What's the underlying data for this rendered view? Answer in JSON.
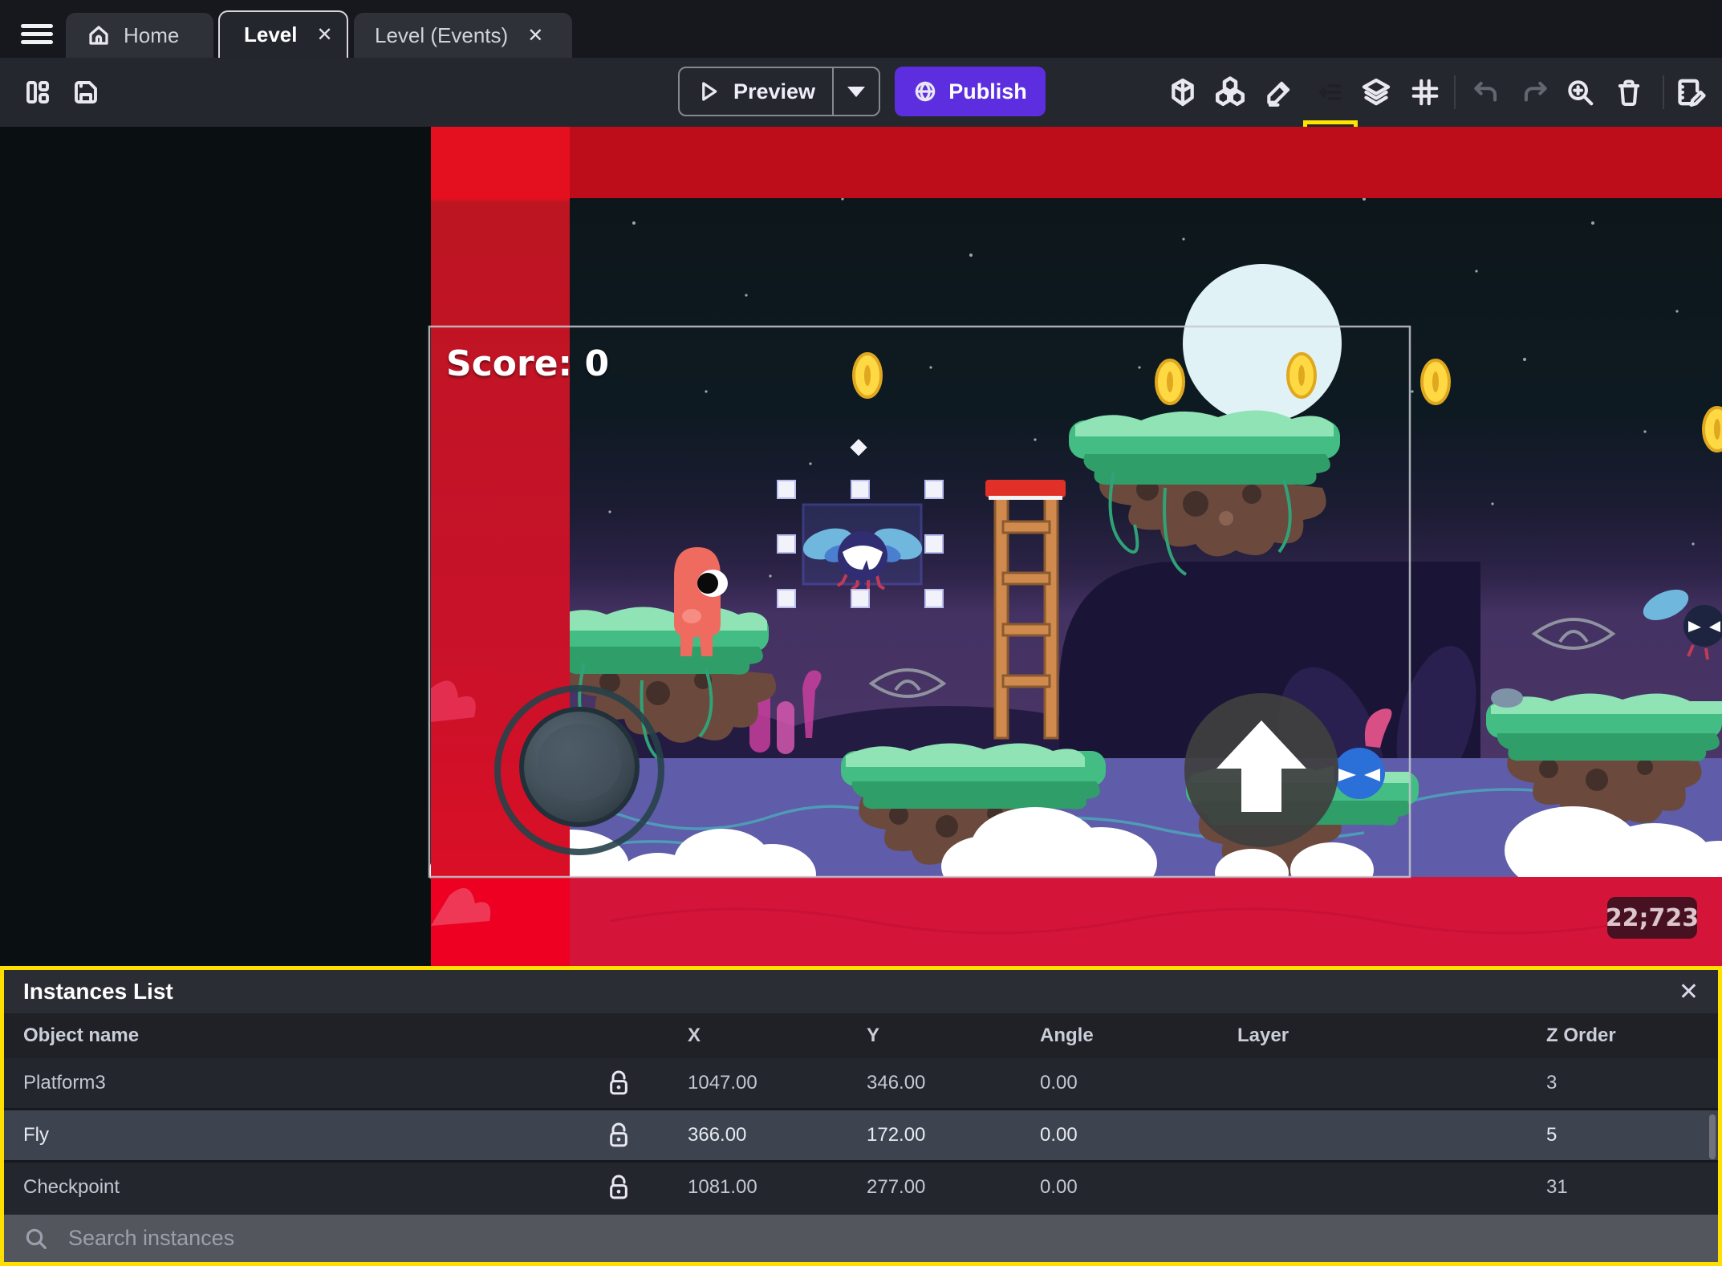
{
  "tab_bar": {
    "home": {
      "label": "Home"
    },
    "level": {
      "label": "Level",
      "close": "✕"
    },
    "level_events": {
      "label": "Level (Events)",
      "close": "✕"
    }
  },
  "toolbar": {
    "preview_label": "Preview",
    "publish_label": "Publish"
  },
  "scene": {
    "score_text": "Score: 0",
    "coords_badge": "22;723"
  },
  "instances_panel": {
    "title": "Instances List",
    "close": "✕",
    "columns": {
      "name": "Object name",
      "x": "X",
      "y": "Y",
      "angle": "Angle",
      "layer": "Layer",
      "z": "Z Order"
    },
    "rows": [
      {
        "name": "Platform3",
        "x": "1047.00",
        "y": "346.00",
        "angle": "0.00",
        "layer": "",
        "z": "3",
        "selected": false
      },
      {
        "name": "Fly",
        "x": "366.00",
        "y": "172.00",
        "angle": "0.00",
        "layer": "",
        "z": "5",
        "selected": true
      },
      {
        "name": "Checkpoint",
        "x": "1081.00",
        "y": "277.00",
        "angle": "0.00",
        "layer": "",
        "z": "31",
        "selected": false
      }
    ],
    "search_placeholder": "Search instances"
  },
  "colors": {
    "accent_purple": "#5c2ee0",
    "highlight_yellow": "#ffe400",
    "panel_highlight_yellow": "#ffdf00",
    "selection_blue": "#5a5fd6",
    "stripe_red": "#c2131f",
    "water_purple": "#5f5ca9"
  }
}
